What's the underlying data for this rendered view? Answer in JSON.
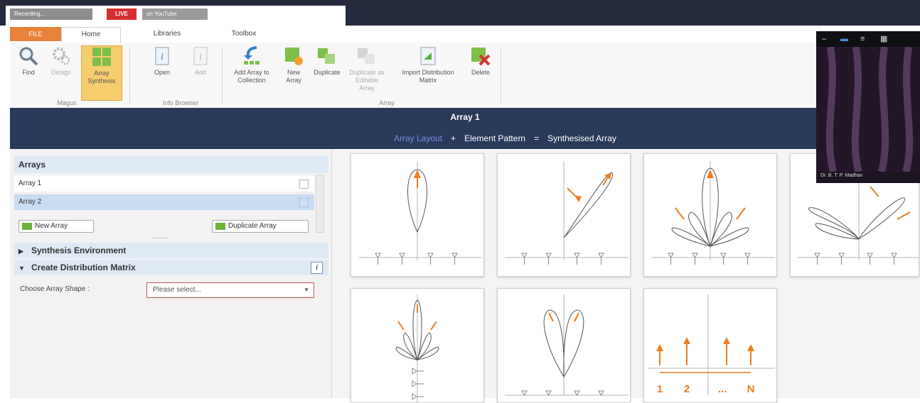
{
  "top": {
    "app_chip": "Recording...",
    "live_badge": "LIVE",
    "channel_chip": "on YouTube"
  },
  "ribbon_tabs": {
    "file": "FILE",
    "home": "Home",
    "libraries": "Libraries",
    "toolbox": "Toolbox"
  },
  "ribbon": {
    "find": "Find",
    "design": "Design",
    "array_synthesis": "Array Synthesis",
    "open": "Open",
    "add": "Add",
    "add_array_to_collection": "Add Array to Collection",
    "new_array": "New Array",
    "duplicate": "Duplicate",
    "duplicate_editable": "Duplicate as Editable Array",
    "import_distribution": "Import Distribution Matrix",
    "delete": "Delete",
    "group_magus": "Magus",
    "group_info_browser": "Info Browser",
    "group_array": "Array"
  },
  "header": {
    "title": "Array 1",
    "array_layout": "Array Layout",
    "plus": "+",
    "element_pattern": "Element Pattern",
    "equals": "=",
    "synthesised_array": "Synthesised Array"
  },
  "panel": {
    "arrays_heading": "Arrays",
    "items": [
      "Array 1",
      "Array 2"
    ],
    "new_array": "New Array",
    "duplicate_array": "Duplicate Array",
    "dots": "......",
    "synthesis_environment": "Synthesis Environment",
    "create_distribution_matrix": "Create Distribution Matrix",
    "info": "i",
    "choose_array_shape": "Choose Array Shape :",
    "select_placeholder": "Please select..."
  },
  "gallery": {
    "label_1": "1",
    "label_2": "2",
    "label_dots": "...",
    "label_n": "N"
  },
  "cam": {
    "name": "Dr. B. T. P. Madhav"
  },
  "colors": {
    "navy": "#2a3a5c",
    "accent_orange": "#e8823a",
    "selection_blue": "#c8dcf2",
    "active_button": "#f6cd6d"
  }
}
